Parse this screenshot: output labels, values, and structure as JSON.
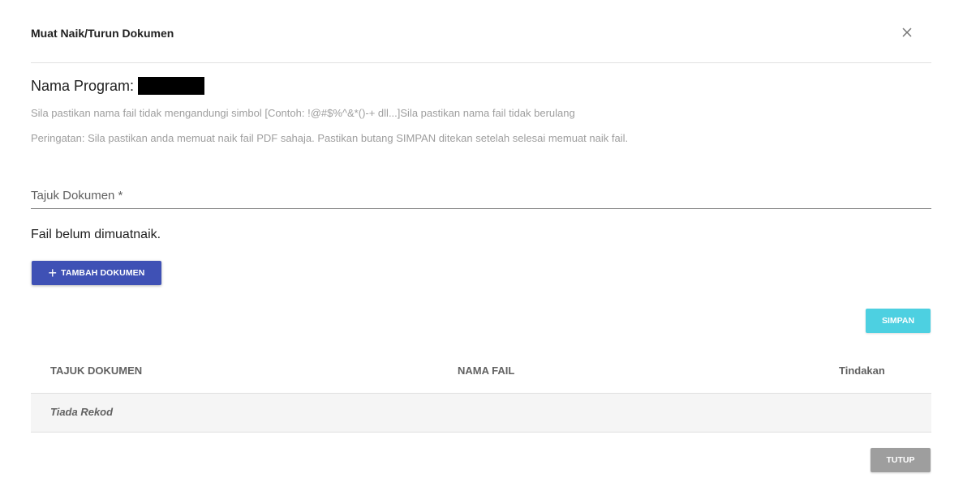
{
  "dialog": {
    "title": "Muat Naik/Turun Dokumen",
    "close_icon": "close-icon"
  },
  "program": {
    "label": "Nama Program:"
  },
  "notes": [
    "Sila pastikan nama fail tidak mengandungi simbol [Contoh: !@#$%^&*()-+ dll...]Sila pastikan nama fail tidak berulang",
    "Peringatan: Sila pastikan anda memuat naik fail PDF sahaja. Pastikan butang SIMPAN ditekan setelah selesai memuat naik fail."
  ],
  "form": {
    "title_field_label": "Tajuk Dokumen *",
    "title_field_value": ""
  },
  "status": {
    "no_file_message": "Fail belum dimuatnaik."
  },
  "buttons": {
    "add_document": "TAMBAH DOKUMEN",
    "add_icon": "plus-icon",
    "save": "SIMPAN",
    "close": "TUTUP"
  },
  "table": {
    "headers": [
      "TAJUK DOKUMEN",
      "NAMA FAIL",
      "Tindakan"
    ],
    "empty_text": "Tiada Rekod"
  },
  "colors": {
    "primary": "#3f51b5",
    "save": "#4dd0e1",
    "close": "#9e9e9e"
  }
}
